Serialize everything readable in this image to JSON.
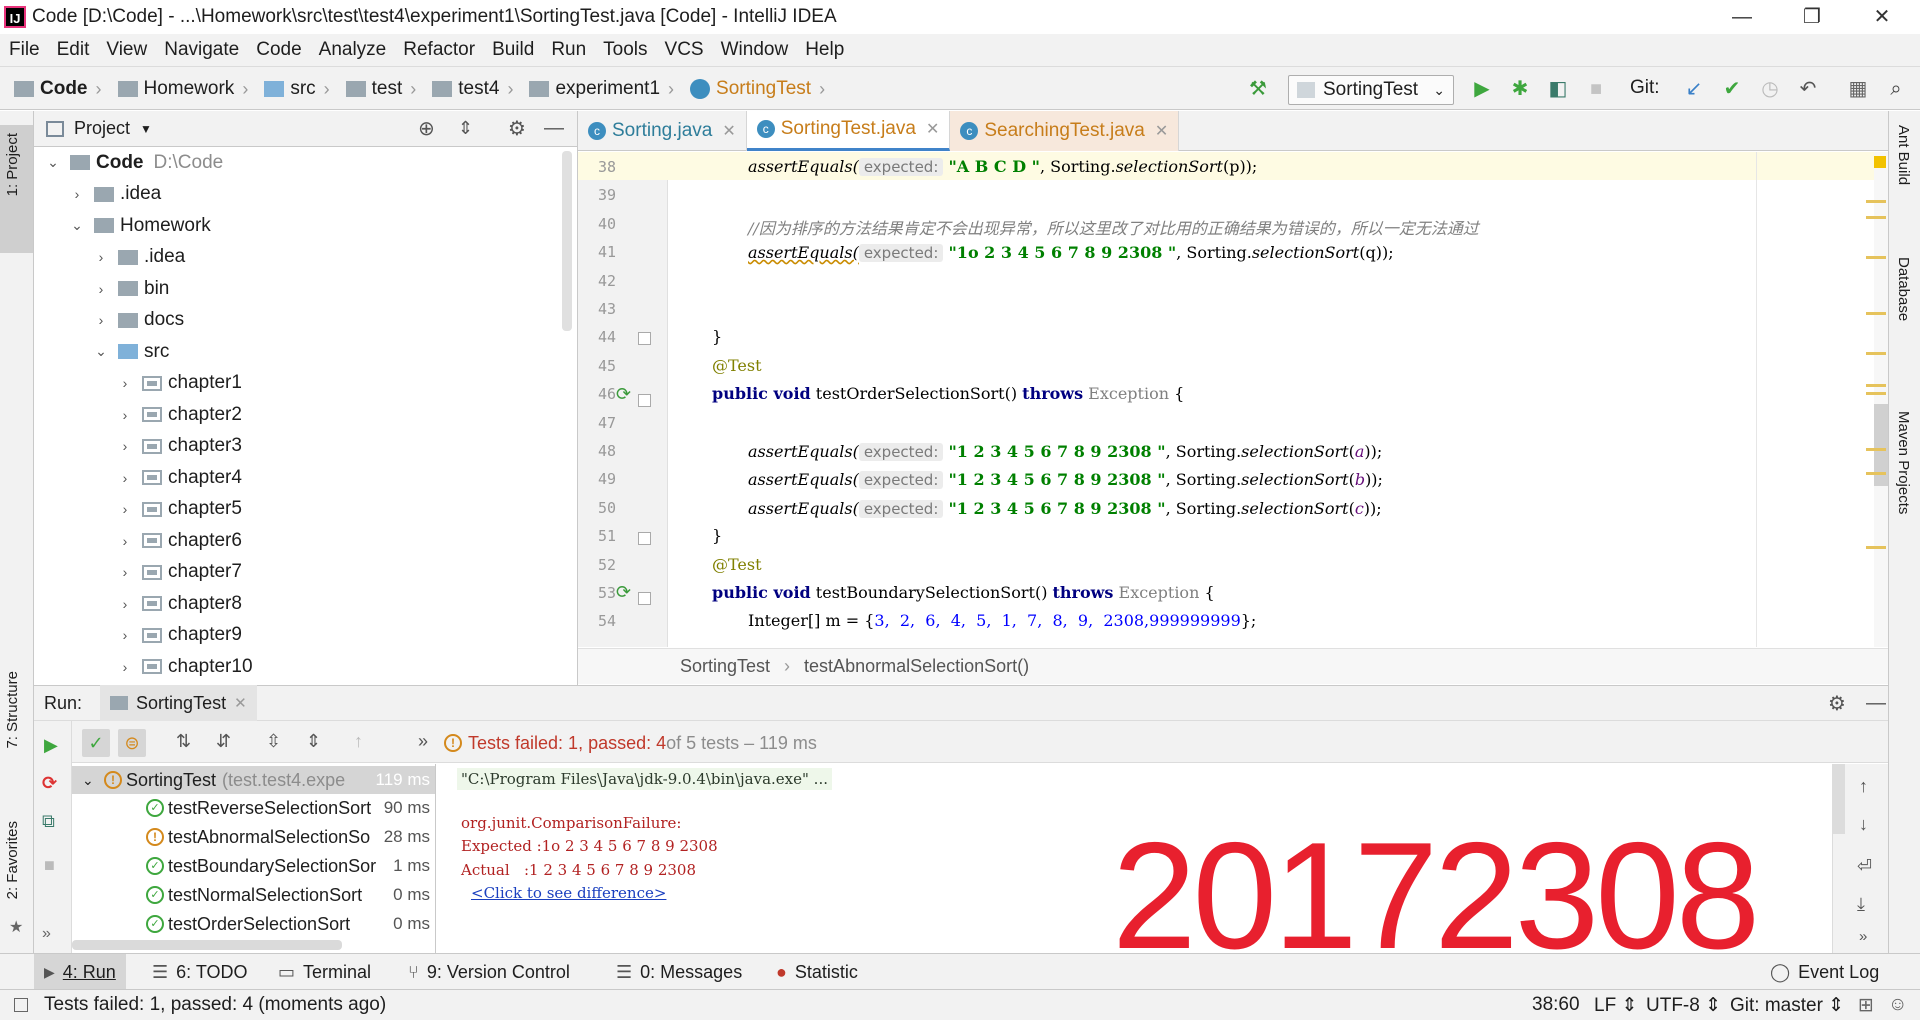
{
  "window": {
    "logo": "IJ",
    "title": "Code [D:\\Code] - ...\\Homework\\src\\test\\test4\\experiment1\\SortingTest.java [Code] - IntelliJ IDEA",
    "minimize": "—",
    "restore": "❐",
    "close": "✕"
  },
  "menu": [
    "File",
    "Edit",
    "View",
    "Navigate",
    "Code",
    "Analyze",
    "Refactor",
    "Build",
    "Run",
    "Tools",
    "VCS",
    "Window",
    "Help"
  ],
  "breadcrumbs": [
    "Code",
    "Homework",
    "src",
    "test",
    "test4",
    "experiment1",
    "SortingTest"
  ],
  "toolbar": {
    "run_config": "SortingTest",
    "git_label": "Git:"
  },
  "project": {
    "title": "Project",
    "tree": [
      {
        "label": "Code",
        "extra": "D:\\Code",
        "arrow": "⌄",
        "indent": 0
      },
      {
        "label": ".idea",
        "arrow": "›",
        "indent": 1
      },
      {
        "label": "Homework",
        "arrow": "⌄",
        "indent": 1
      },
      {
        "label": ".idea",
        "arrow": "›",
        "indent": 2
      },
      {
        "label": "bin",
        "arrow": "›",
        "indent": 2
      },
      {
        "label": "docs",
        "arrow": "›",
        "indent": 2
      },
      {
        "label": "src",
        "arrow": "⌄",
        "indent": 2
      },
      {
        "label": "chapter1",
        "arrow": "›",
        "indent": 3
      },
      {
        "label": "chapter2",
        "arrow": "›",
        "indent": 3
      },
      {
        "label": "chapter3",
        "arrow": "›",
        "indent": 3
      },
      {
        "label": "chapter4",
        "arrow": "›",
        "indent": 3
      },
      {
        "label": "chapter5",
        "arrow": "›",
        "indent": 3
      },
      {
        "label": "chapter6",
        "arrow": "›",
        "indent": 3
      },
      {
        "label": "chapter7",
        "arrow": "›",
        "indent": 3
      },
      {
        "label": "chapter8",
        "arrow": "›",
        "indent": 3
      },
      {
        "label": "chapter9",
        "arrow": "›",
        "indent": 3
      },
      {
        "label": "chapter10",
        "arrow": "›",
        "indent": 3
      }
    ]
  },
  "editor": {
    "tabs": [
      {
        "label": "Sorting.java",
        "active": false,
        "color": "#3d8ebf"
      },
      {
        "label": "SortingTest.java",
        "active": true,
        "color": "#3d8ebf"
      },
      {
        "label": "SearchingTest.java",
        "active": false,
        "color": "#c0392b"
      }
    ],
    "line_numbers": [
      "38",
      "39",
      "40",
      "41",
      "42",
      "43",
      "44",
      "45",
      "46",
      "47",
      "48",
      "49",
      "50",
      "51",
      "52",
      "53",
      "54"
    ],
    "hint_expected": "expected:",
    "code": {
      "l38_call": "assertEquals(",
      "l38_str": "\"A B C D \"",
      "l38_rest": ", Sorting.",
      "l38_method": "selectionSort",
      "l38_end": "(p));",
      "l40_comment": "//因为排序的方法结果肯定不会出现异常，所以这里改了对比用的正确结果为错误的，所以一定无法通过",
      "l41_call": "assertEquals(",
      "l41_str": "\"1o 2 3 4 5 6 7 8 9 2308 \"",
      "l41_rest": ", Sorting.",
      "l41_method": "selectionSort",
      "l41_end": "(q));",
      "l44": "}",
      "l45": "@Test",
      "l46_kw": "public void",
      "l46_name": " testOrderSelectionSort() ",
      "l46_throws": "throws",
      "l46_exc": " Exception",
      "l46_end": " {",
      "l48_call": "assertEquals(",
      "l48_str": "\"1 2 3 4 5 6 7 8 9 2308 \"",
      "l48_rest": ", Sorting.",
      "l48_method": "selectionSort",
      "l48_arg": "a",
      "l49_call": "assertEquals(",
      "l49_str": "\"1 2 3 4 5 6 7 8 9 2308 \"",
      "l49_rest": ", Sorting.",
      "l49_method": "selectionSort",
      "l49_arg": "b",
      "l50_call": "assertEquals(",
      "l50_str": "\"1 2 3 4 5 6 7 8 9 2308 \"",
      "l50_rest": ", Sorting.",
      "l50_method": "selectionSort",
      "l50_arg": "c",
      "l51": "}",
      "l52": "@Test",
      "l53_kw": "public void",
      "l53_name": " testBoundarySelectionSort() ",
      "l53_throws": "throws",
      "l53_exc": " Exception",
      "l53_end": " {",
      "l54_pre": "Integer[] m = {",
      "l54_nums": "3,  2,  6,  4,  5,  1,  7,  8,  9,  2308,999999999",
      "l54_end": "};"
    },
    "breadcrumb_class": "SortingTest",
    "breadcrumb_sep": "›",
    "breadcrumb_method": "testAbnormalSelectionSort()"
  },
  "run": {
    "label": "Run:",
    "tab": "SortingTest",
    "summary_failed": "Tests failed: 1",
    "summary_passed": ", passed: 4",
    "summary_rest": " of 5 tests – 119 ms",
    "tree": {
      "root": "SortingTest",
      "root_pkg": "(test.test4.expe",
      "root_time": "119 ms",
      "tests": [
        {
          "name": "testReverseSelectionSort",
          "time": "90 ms",
          "status": "ok"
        },
        {
          "name": "testAbnormalSelectionSo",
          "time": "28 ms",
          "status": "fail"
        },
        {
          "name": "testBoundarySelectionSor",
          "time": "1 ms",
          "status": "ok"
        },
        {
          "name": "testNormalSelectionSort",
          "time": "0 ms",
          "status": "ok"
        },
        {
          "name": "testOrderSelectionSort",
          "time": "0 ms",
          "status": "ok"
        }
      ]
    },
    "console": {
      "cmd": "\"C:\\Program Files\\Java\\jdk-9.0.4\\bin\\java.exe\" ...",
      "failure": "org.junit.ComparisonFailure:",
      "expected": "Expected :1o 2 3 4 5 6 7 8 9 2308",
      "actual": "Actual   :1 2 3 4 5 6 7 8 9 2308",
      "diff_link": "<Click to see difference>"
    }
  },
  "watermark": "20172308",
  "side_tabs": {
    "project": "1: Project",
    "structure": "7: Structure",
    "favorites": "2: Favorites",
    "ant": "Ant Build",
    "database": "Database",
    "maven": "Maven Projects"
  },
  "bottom_tabs": [
    "4: Run",
    "6: TODO",
    "Terminal",
    "9: Version Control",
    "0: Messages",
    "Statistic"
  ],
  "event_log": "Event Log",
  "status": {
    "message": "Tests failed: 1, passed: 4 (moments ago)",
    "position": "38:60",
    "line_sep": "LF",
    "encoding": "UTF-8",
    "git": "Git: master"
  }
}
